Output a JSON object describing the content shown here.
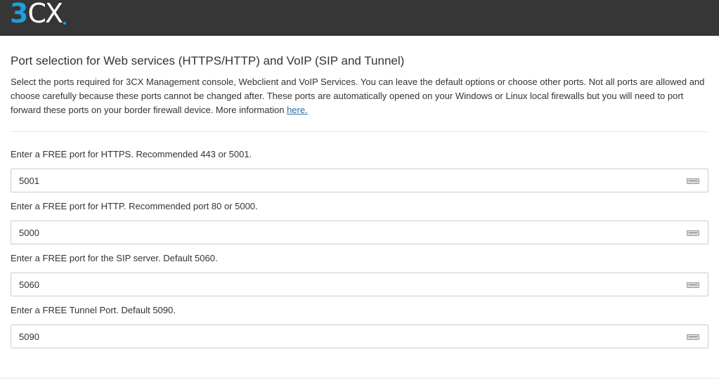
{
  "header": {
    "logo_number": "3",
    "logo_text": "CX"
  },
  "section": {
    "title": "Port selection for Web services (HTTPS/HTTP) and VoIP (SIP and Tunnel)",
    "intro": "Select the ports required for 3CX Management console, Webclient and VoIP Services. You can leave the default options or choose other ports. Not all ports are allowed and choose carefully because these ports cannot be changed after. These ports are automatically opened on your Windows or Linux local firewalls but you will need to port forward these ports on your border firewall device. More information ",
    "link_text": "here."
  },
  "fields": [
    {
      "label": "Enter a FREE port for HTTPS. Recommended 443 or 5001.",
      "value": "5001"
    },
    {
      "label": "Enter a FREE port for HTTP. Recommended port 80 or 5000.",
      "value": "5000"
    },
    {
      "label": "Enter a FREE port for the SIP server. Default 5060.",
      "value": "5060"
    },
    {
      "label": "Enter a FREE Tunnel Port. Default 5090.",
      "value": "5090"
    }
  ],
  "colors": {
    "header_bg": "#363636",
    "logo_accent": "#1aa0dc",
    "link": "#2a6ea6"
  }
}
